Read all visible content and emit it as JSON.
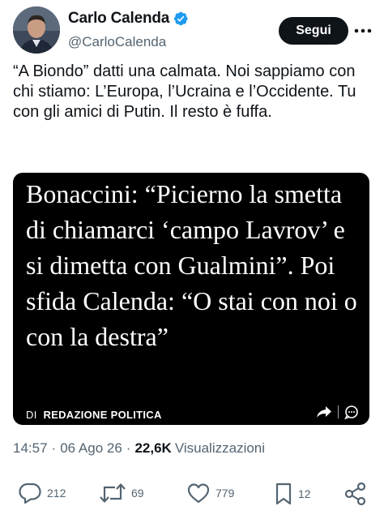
{
  "user": {
    "display_name": "Carlo Calenda",
    "handle": "@CarloCalenda"
  },
  "header": {
    "follow_label": "Segui"
  },
  "tweet": {
    "text": "“A Biondo” datti una calmata. Noi sappiamo con chi stiamo: L’Europa, l’Ucraina e l’Occidente. Tu con gli amici di Putin. Il resto è fuffa."
  },
  "card": {
    "headline": "Bonaccini: “Picierno la smetta di chiamarci ‘campo Lavrov’ e si dimetta con Gualmini”. Poi sfida Calenda: “O stai con noi o con la destra”",
    "source_prefix": "DI",
    "source_name": "REDAZIONE POLITICA"
  },
  "meta": {
    "time": "14:57",
    "date": "06 Ago 26",
    "views_count": "22,6K",
    "views_label": "Visualizzazioni"
  },
  "actions": {
    "replies": "212",
    "retweets": "69",
    "likes": "779",
    "bookmarks": "12"
  },
  "colors": {
    "text": "#0f1419",
    "secondary": "#536471",
    "verified": "#1d9bf0",
    "card_bg": "#000000"
  }
}
